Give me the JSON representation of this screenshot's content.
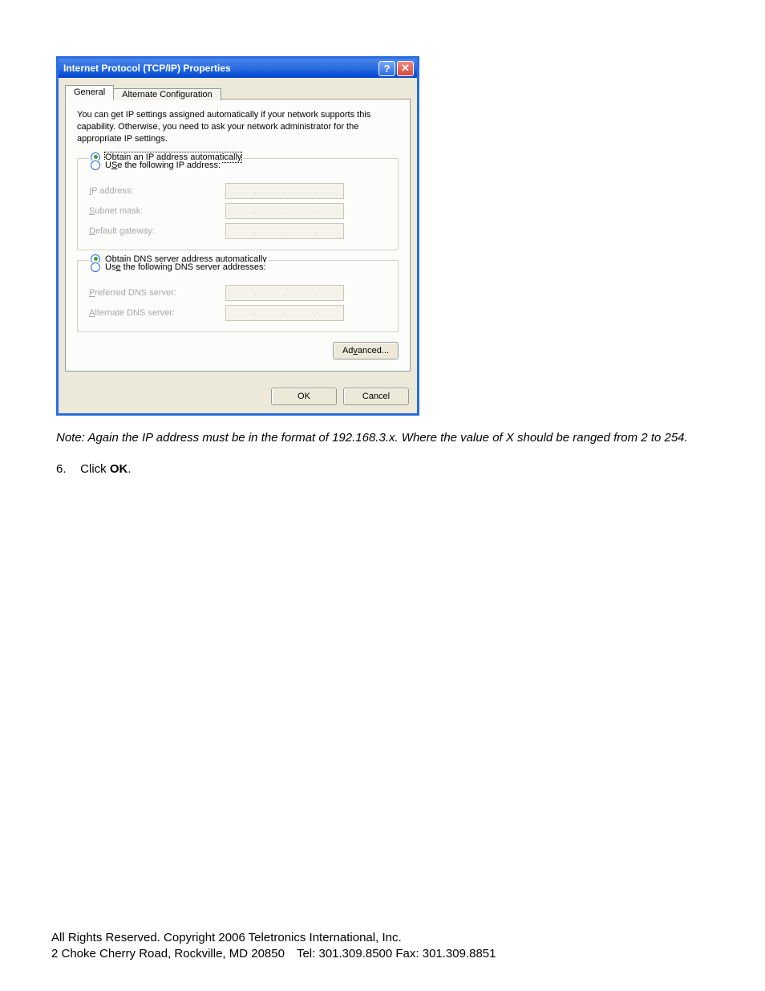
{
  "dialog": {
    "title": "Internet Protocol (TCP/IP) Properties",
    "tabs": {
      "general": "General",
      "alt": "Alternate Configuration"
    },
    "intro": "You can get IP settings assigned automatically if your network supports this capability. Otherwise, you need to ask your network administrator for the appropriate IP settings.",
    "ip_group": {
      "auto_pre": "O",
      "auto_rest": "btain an IP address automatically",
      "manual_pre": "Use the following IP address:",
      "manual_u": "S",
      "fields": {
        "ip_pre": "I",
        "ip_rest": "P address:",
        "mask_pre": "S",
        "mask_rest": "ubnet mask:",
        "gw_pre": "D",
        "gw_rest": "efault gateway:"
      }
    },
    "dns_group": {
      "auto_pre": "b",
      "auto_head": "O",
      "auto_tail": "tain DNS server address automatically",
      "manual_pre": "e",
      "manual_head": "Us",
      "manual_tail": " the following DNS server addresses:",
      "fields": {
        "pref_pre": "P",
        "pref_rest": "referred DNS server:",
        "alt_pre": "A",
        "alt_rest": "lternate DNS server:"
      }
    },
    "advanced_pre": "v",
    "advanced_head": "Ad",
    "advanced_tail": "anced...",
    "ok": "OK",
    "cancel": "Cancel"
  },
  "doc": {
    "note": "Note: Again the IP address must be in the format of 192.168.3.x. Where the value of X should be ranged from 2 to 254.",
    "step_num": "6.",
    "step_text_a": "Click ",
    "step_text_b": "OK",
    "step_text_c": "."
  },
  "footer": {
    "line1": "All Rights Reserved. Copyright 2006 Teletronics International, Inc.",
    "line2": "2 Choke Cherry Road, Rockville, MD 20850 Tel: 301.309.8500 Fax: 301.309.8851"
  }
}
